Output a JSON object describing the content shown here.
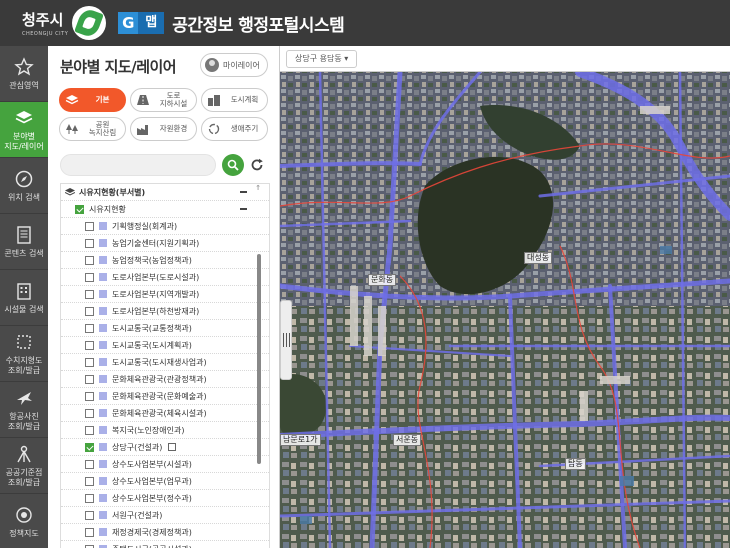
{
  "header": {
    "city_name": "청주시",
    "city_name_en": "CHEONGJU CITY",
    "gmap_g": "G",
    "gmap_map": "맵",
    "system_title": "공간정보 행정포털시스템"
  },
  "nav": [
    {
      "label": "관심영역",
      "icon": "star-icon",
      "active": false
    },
    {
      "label": "분야별\n지도/레이어",
      "icon": "layers-icon",
      "active": true
    },
    {
      "label": "위치 검색",
      "icon": "compass-icon",
      "active": false
    },
    {
      "label": "콘텐츠 검색",
      "icon": "document-icon",
      "active": false
    },
    {
      "label": "시설물 검색",
      "icon": "building-icon",
      "active": false
    },
    {
      "label": "수치지형도\n조회/발급",
      "icon": "crop-icon",
      "active": false
    },
    {
      "label": "항공사진\n조회/발급",
      "icon": "airplane-icon",
      "active": false
    },
    {
      "label": "공공기준점\n조회/발급",
      "icon": "tripod-icon",
      "active": false
    },
    {
      "label": "정책지도",
      "icon": "target-icon",
      "active": false
    }
  ],
  "panel": {
    "title": "분야별 지도/레이어",
    "my_layer_label": "마이레이어",
    "categories": [
      {
        "label": "기본",
        "icon": "stack-icon",
        "active": true
      },
      {
        "label": "도로\n지하시설",
        "icon": "road-icon",
        "active": false
      },
      {
        "label": "도시계획",
        "icon": "city-icon",
        "active": false
      },
      {
        "label": "공원\n녹지산림",
        "icon": "tree-icon",
        "active": false
      },
      {
        "label": "자원환경",
        "icon": "factory-icon",
        "active": false
      },
      {
        "label": "생애주기",
        "icon": "cycle-icon",
        "active": false
      }
    ],
    "search_placeholder": ""
  },
  "tree": {
    "root": "시유지현황(부서별)",
    "group": "시유지현황",
    "items": [
      {
        "label": "기획행정실(회계과)",
        "checked": false,
        "edit": false
      },
      {
        "label": "농업기술센터(지원기획과)",
        "checked": false,
        "edit": false
      },
      {
        "label": "농업정책국(농업정책과)",
        "checked": false,
        "edit": false
      },
      {
        "label": "도로사업본부(도로시설과)",
        "checked": false,
        "edit": false
      },
      {
        "label": "도로사업본부(지역개발과)",
        "checked": false,
        "edit": false
      },
      {
        "label": "도로사업본부(하천방재과)",
        "checked": false,
        "edit": false
      },
      {
        "label": "도시교통국(교통정책과)",
        "checked": false,
        "edit": false
      },
      {
        "label": "도시교통국(도시계획과)",
        "checked": false,
        "edit": false
      },
      {
        "label": "도시교통국(도시재생사업과)",
        "checked": false,
        "edit": false
      },
      {
        "label": "문화체육관광국(관광정책과)",
        "checked": false,
        "edit": false
      },
      {
        "label": "문화체육관광국(문화예술과)",
        "checked": false,
        "edit": false
      },
      {
        "label": "문화체육관광국(체육시설과)",
        "checked": false,
        "edit": false
      },
      {
        "label": "복지국(노인장애인과)",
        "checked": false,
        "edit": false
      },
      {
        "label": "상당구(건설과)",
        "checked": true,
        "edit": true
      },
      {
        "label": "상수도사업본부(시설과)",
        "checked": false,
        "edit": false
      },
      {
        "label": "상수도사업본부(업무과)",
        "checked": false,
        "edit": false
      },
      {
        "label": "상수도사업본부(정수과)",
        "checked": false,
        "edit": false
      },
      {
        "label": "서원구(건설과)",
        "checked": false,
        "edit": false
      },
      {
        "label": "재정경제국(경제정책과)",
        "checked": false,
        "edit": false
      },
      {
        "label": "주택도시국(공공시설과)",
        "checked": false,
        "edit": false
      }
    ]
  },
  "map": {
    "location_select": "상당구 용담동 ▾",
    "labels": [
      {
        "text": "문화동",
        "name": "map-label-munhwa"
      },
      {
        "text": "대성동",
        "name": "map-label-daeseong"
      },
      {
        "text": "서운동",
        "name": "map-label-seoun"
      },
      {
        "text": "탑동",
        "name": "map-label-tap"
      },
      {
        "text": "남문로1가",
        "name": "map-label-nammunro"
      }
    ]
  }
}
